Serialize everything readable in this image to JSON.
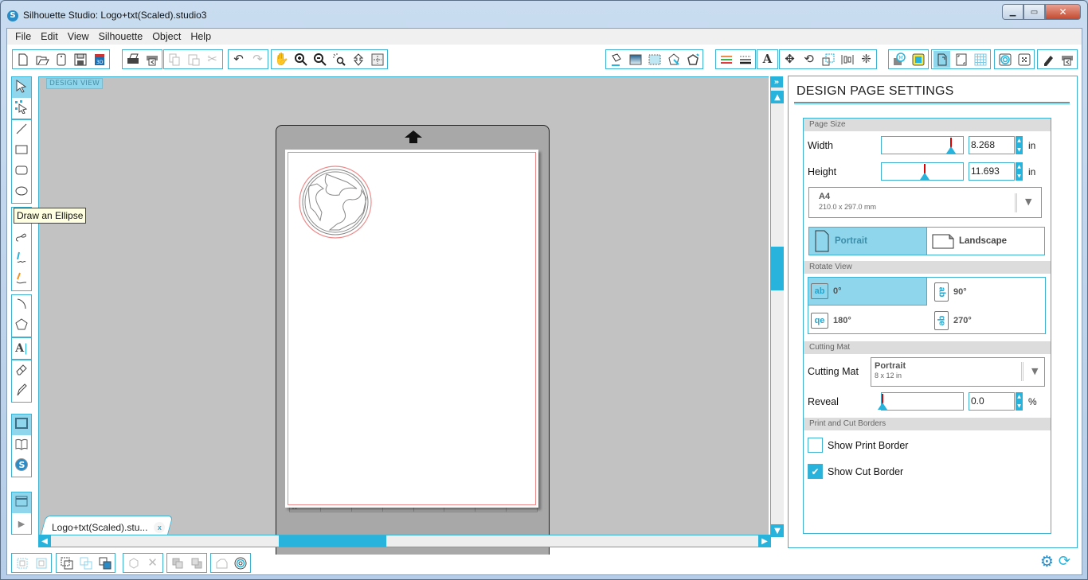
{
  "window": {
    "title": "Silhouette Studio: Logo+txt(Scaled).studio3",
    "app_icon": "silhouette-logo-icon",
    "controls": {
      "minimize": "minimize-icon",
      "maximize": "maximize-icon",
      "close": "close-icon"
    }
  },
  "menu": [
    "File",
    "Edit",
    "View",
    "Silhouette",
    "Object",
    "Help"
  ],
  "toolbar_left": [
    {
      "group": "file",
      "items": [
        "new-document-icon",
        "open-folder-icon",
        "open-template-icon",
        "save-icon",
        "save-to-library-icon"
      ]
    },
    {
      "group": "send",
      "items": [
        "print-icon",
        "send-to-cutter-icon"
      ]
    },
    {
      "group": "clipboard",
      "items": [
        "copy-icon",
        "paste-icon",
        "cut-icon"
      ]
    },
    {
      "group": "history",
      "items": [
        "undo-icon",
        "redo-icon"
      ]
    },
    {
      "group": "zoom",
      "items": [
        "pan-hand-icon",
        "zoom-in-icon",
        "zoom-out-icon",
        "zoom-selected-icon",
        "zoom-drag-icon",
        "fit-to-page-icon"
      ]
    }
  ],
  "toolbar_right": [
    {
      "group": "fill",
      "items": [
        "fill-color-icon",
        "fill-gradient-icon",
        "fill-pattern-icon",
        "line-color-icon",
        "line-style-icon"
      ]
    },
    {
      "group": "lines",
      "items": [
        "line-color-panel-icon",
        "line-style-panel-icon"
      ]
    },
    {
      "group": "text",
      "items": [
        "text-style-icon"
      ]
    },
    {
      "group": "transform",
      "items": [
        "transform-icon",
        "rotate-icon",
        "scale-icon",
        "align-icon",
        "replicate-icon"
      ]
    },
    {
      "group": "modify",
      "items": [
        "modify-icon",
        "offset-icon"
      ]
    },
    {
      "group": "page",
      "items": [
        "page-settings-icon",
        "registration-marks-icon",
        "grid-settings-icon"
      ]
    },
    {
      "group": "trace",
      "items": [
        "trace-icon",
        "pixscan-icon"
      ]
    },
    {
      "group": "cut",
      "items": [
        "sketch-icon",
        "cut-settings-icon"
      ]
    }
  ],
  "left_tools": [
    {
      "name": "select-tool",
      "icon": "pointer-arrow-icon",
      "active": true
    },
    {
      "name": "edit-points-tool",
      "icon": "edit-points-icon"
    },
    {
      "name": "line-tool",
      "icon": "line-icon"
    },
    {
      "name": "rectangle-tool",
      "icon": "rectangle-icon"
    },
    {
      "name": "rounded-rectangle-tool",
      "icon": "rounded-rectangle-icon"
    },
    {
      "name": "ellipse-tool",
      "icon": "ellipse-icon"
    },
    {
      "name": "polygon-tool",
      "icon": "polygon-tool-icon"
    },
    {
      "name": "curve-tool",
      "icon": "curve-icon"
    },
    {
      "name": "freehand-tool",
      "icon": "freehand-icon"
    },
    {
      "name": "smooth-freehand-tool",
      "icon": "smooth-freehand-icon"
    },
    {
      "name": "arc-tool",
      "icon": "arc-icon"
    },
    {
      "name": "regular-polygon-tool",
      "icon": "pentagon-icon"
    },
    {
      "name": "text-tool",
      "icon": "text-tool-icon"
    },
    {
      "name": "eraser-tool",
      "icon": "eraser-icon"
    },
    {
      "name": "knife-tool",
      "icon": "knife-icon"
    },
    {
      "name": "design-view",
      "icon": "design-view-icon",
      "active": true
    },
    {
      "name": "library",
      "icon": "library-book-icon"
    },
    {
      "name": "online-store",
      "icon": "silhouette-store-icon"
    },
    {
      "name": "send-panel",
      "icon": "send-panel-icon",
      "active": true
    },
    {
      "name": "expand",
      "icon": "play-arrow-icon"
    }
  ],
  "canvas": {
    "view_badge": "DESIGN VIEW",
    "tooltip": "Draw an Ellipse",
    "document_tab": "Logo+txt(Scaled).stu...",
    "document_tab_close": "x",
    "mat_ruler_label": "12"
  },
  "scroll": {
    "vertical_position": 0.4,
    "horizontal_position": 0.38
  },
  "bottom_tools": [
    {
      "group": "grouping",
      "items": [
        "group-icon",
        "ungroup-icon"
      ]
    },
    {
      "group": "compound",
      "items": [
        "make-compound-icon",
        "release-compound-icon",
        "merge-icon"
      ]
    },
    {
      "group": "weld",
      "items": [
        "weld-icon",
        "delete-icon"
      ]
    },
    {
      "group": "arrange",
      "items": [
        "bring-forward-icon",
        "send-backward-icon"
      ]
    },
    {
      "group": "shape",
      "items": [
        "shape-icon",
        "offset-rings-icon"
      ]
    }
  ],
  "panel": {
    "collapse_label": "»",
    "title": "DESIGN PAGE SETTINGS",
    "page_size": {
      "header": "Page Size",
      "width_label": "Width",
      "width_value": "8.268",
      "width_unit": "in",
      "width_slider_fraction": 0.84,
      "height_label": "Height",
      "height_value": "11.693",
      "height_unit": "in",
      "height_slider_fraction": 0.52,
      "preset_name": "A4",
      "preset_size": "210.0 x 297.0 mm",
      "orientation": [
        {
          "label": "Portrait",
          "active": true
        },
        {
          "label": "Landscape",
          "active": false
        }
      ]
    },
    "rotate_view": {
      "header": "Rotate View",
      "options": [
        {
          "label": "0°",
          "glyph": "ab",
          "active": true
        },
        {
          "label": "90°",
          "glyph": "ab",
          "active": false
        },
        {
          "label": "180°",
          "glyph": "qe",
          "active": false
        },
        {
          "label": "270°",
          "glyph": "qe",
          "active": false
        }
      ]
    },
    "cutting_mat": {
      "header": "Cutting Mat",
      "label": "Cutting Mat",
      "value": "Portrait",
      "value_sub": "8 x 12 in",
      "reveal_label": "Reveal",
      "reveal_value": "0.0",
      "reveal_unit": "%",
      "reveal_slider_fraction": 0.0
    },
    "borders": {
      "header": "Print and Cut Borders",
      "show_print_border": {
        "label": "Show Print Border",
        "checked": false
      },
      "show_cut_border": {
        "label": "Show Cut Border",
        "checked": true
      }
    }
  },
  "footer_icons": [
    "preferences-gear-icon",
    "sync-icon"
  ],
  "colors": {
    "accent": "#27b3db",
    "active_fill": "#8fd5ec",
    "canvas_bg": "#c2c2c2",
    "mat": "#a8a8a8",
    "cut_border": "#ef8a8a"
  }
}
